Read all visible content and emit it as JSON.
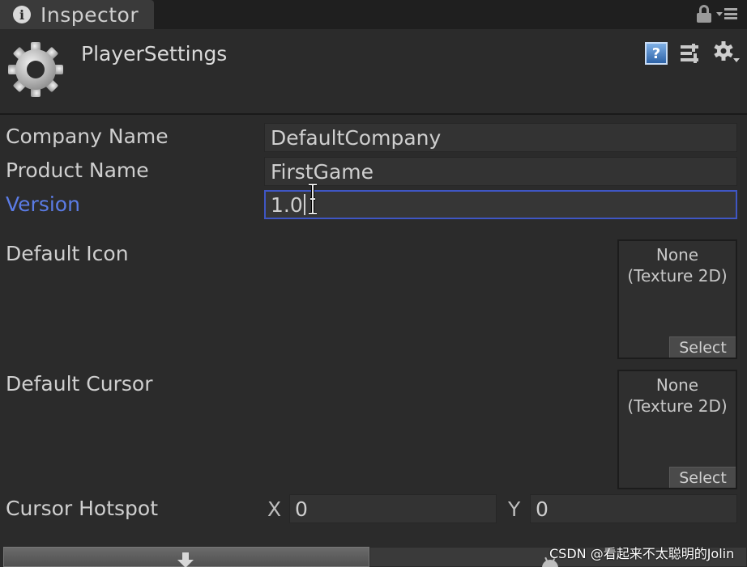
{
  "tab": {
    "label": "Inspector"
  },
  "header": {
    "title": "PlayerSettings"
  },
  "fields": {
    "company": {
      "label": "Company Name",
      "value": "DefaultCompany"
    },
    "product": {
      "label": "Product Name",
      "value": "FirstGame"
    },
    "version": {
      "label": "Version",
      "value": "1.0"
    }
  },
  "default_icon": {
    "label": "Default Icon",
    "slot_line1": "None",
    "slot_line2": "(Texture 2D)",
    "select_label": "Select"
  },
  "default_cursor": {
    "label": "Default Cursor",
    "slot_line1": "None",
    "slot_line2": "(Texture 2D)",
    "select_label": "Select"
  },
  "cursor_hotspot": {
    "label": "Cursor Hotspot",
    "x_label": "X",
    "x_value": "0",
    "y_label": "Y",
    "y_value": "0"
  },
  "watermark": "CSDN @看起来不太聪明的Jolin",
  "colors": {
    "active_label": "#5b7ce6",
    "focus_border": "#3f56c4",
    "help_blue": "#2d63a8"
  },
  "icons": [
    "info-icon",
    "lock-icon",
    "menu-icon",
    "cog-icon",
    "help-icon",
    "preset-icon",
    "settings-icon",
    "download-icon",
    "android-icon"
  ]
}
